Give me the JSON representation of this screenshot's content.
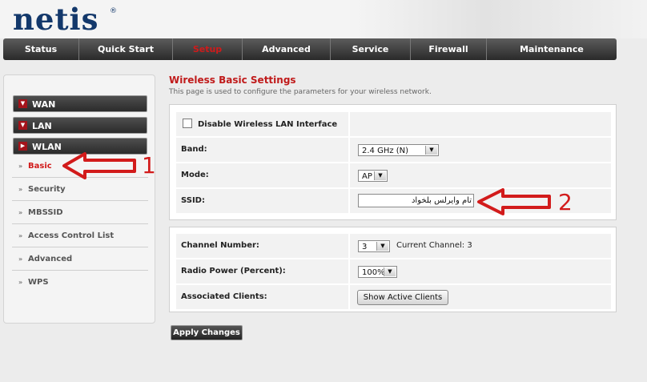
{
  "brand": {
    "logo": "netis",
    "reg_mark": "®"
  },
  "nav": {
    "items": [
      {
        "label": "Status",
        "active": false
      },
      {
        "label": "Quick Start",
        "active": false
      },
      {
        "label": "Setup",
        "active": true
      },
      {
        "label": "Advanced",
        "active": false
      },
      {
        "label": "Service",
        "active": false
      },
      {
        "label": "Firewall",
        "active": false
      },
      {
        "label": "Maintenance",
        "active": false
      }
    ]
  },
  "sidebar": {
    "groups": [
      {
        "label": "WAN",
        "icon": "chevron-down-icon"
      },
      {
        "label": "LAN",
        "icon": "chevron-down-icon"
      },
      {
        "label": "WLAN",
        "icon": "chevron-right-icon"
      }
    ],
    "subitems": [
      {
        "label": "Basic",
        "active": true
      },
      {
        "label": "Security",
        "active": false
      },
      {
        "label": "MBSSID",
        "active": false
      },
      {
        "label": "Access Control List",
        "active": false
      },
      {
        "label": "Advanced",
        "active": false
      },
      {
        "label": "WPS",
        "active": false
      }
    ],
    "bullet": "»"
  },
  "page": {
    "title": "Wireless Basic Settings",
    "description": "This page is used to configure the parameters for your wireless network."
  },
  "basic": {
    "disable_label": "Disable Wireless LAN Interface",
    "disable_checked": false,
    "band_label": "Band:",
    "band_value": "2.4 GHz (N)",
    "mode_label": "Mode:",
    "mode_value": "AP",
    "ssid_label": "SSID:",
    "ssid_value": "تام وايرلس بلخواد"
  },
  "advanced": {
    "channel_label": "Channel Number:",
    "channel_value": "3",
    "current_channel": "Current Channel: 3",
    "power_label": "Radio Power (Percent):",
    "power_value": "100%",
    "clients_label": "Associated Clients:",
    "show_clients_button": "Show Active Clients"
  },
  "apply_button": "Apply Changes",
  "annotations": {
    "one": "1",
    "two": "2",
    "color": "#d21b1b"
  },
  "colors": {
    "accent_red": "#c01a1a",
    "nav_dark": "#2a2a2a",
    "logo_blue": "#13386b"
  }
}
